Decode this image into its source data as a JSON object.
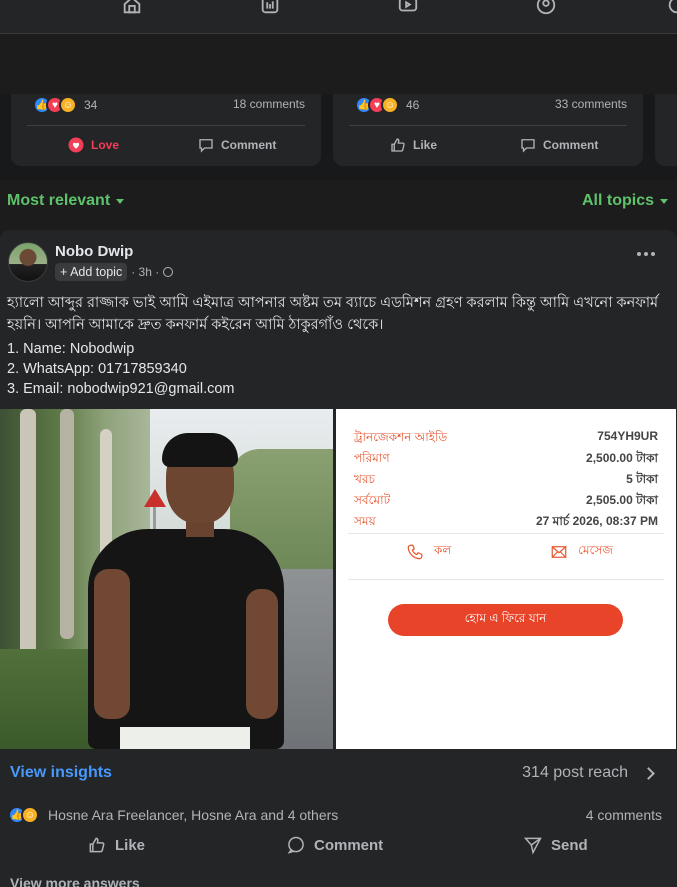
{
  "nav": {
    "icons": [
      "home-icon",
      "pages-icon",
      "video-icon",
      "groups-icon",
      "more-icon"
    ]
  },
  "carousel": {
    "cards": [
      {
        "reaction_count": "34",
        "comment_count": "18 comments",
        "action_primary": "Love",
        "action_secondary": "Comment"
      },
      {
        "reaction_count": "46",
        "comment_count": "33 comments",
        "action_primary": "Like",
        "action_secondary": "Comment"
      }
    ]
  },
  "filters": {
    "left": "Most relevant",
    "right": "All topics"
  },
  "post": {
    "author": "Nobo Dwip",
    "add_topic": "+ Add topic",
    "time": "· 3h ·",
    "text": "হ্যালো আব্দুর রাজ্জাক ভাই আমি এইমাত্র আপনার অষ্টম তম ব্যাচে এডমিশন গ্রহণ করলাম কিন্তু আমি এখনো কনফার্ম হয়নি। আপনি আমাকে দ্রুত কনফার্ম কইরেন আমি ঠাকুরগাঁও থেকে।",
    "details": [
      "1. Name: Nobodwip",
      "2. WhatsApp: 01717859340",
      "3. Email: nobodwip921@gmail.com"
    ],
    "receipt": {
      "rows": [
        {
          "label": "ট্রানজেকশন আইডি",
          "value": "754YH9UR"
        },
        {
          "label": "পরিমাণ",
          "value": "2,500.00 টাকা"
        },
        {
          "label": "খরচ",
          "value": "5 টাকা"
        },
        {
          "label": "সর্বমোট",
          "value": "2,505.00 টাকা"
        },
        {
          "label": "সময়",
          "value": "27 মার্চ 2026, 08:37 PM"
        }
      ],
      "call_label": "কল",
      "message_label": "মেসেজ",
      "home_button": "হোম এ ফিরে যান"
    },
    "insights_label": "View insights",
    "reach": "314 post reach",
    "reactors": "Hosne Ara Freelancer, Hosne Ara and 4 others",
    "comments_count": "4 comments",
    "actions": {
      "like": "Like",
      "comment": "Comment",
      "send": "Send"
    },
    "view_more": "View more answers"
  },
  "colors": {
    "accent_green": "#5ec26a",
    "link_blue": "#4599ff",
    "receipt_orange": "#e8552f"
  }
}
